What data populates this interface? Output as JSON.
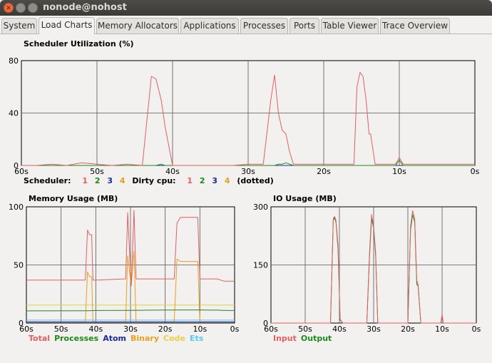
{
  "window": {
    "title": "nonode@nohost"
  },
  "tabs": [
    {
      "label": "System"
    },
    {
      "label": "Load Charts"
    },
    {
      "label": "Memory Allocators"
    },
    {
      "label": "Applications"
    },
    {
      "label": "Processes"
    },
    {
      "label": "Ports"
    },
    {
      "label": "Table Viewer"
    },
    {
      "label": "Trace Overview"
    }
  ],
  "active_tab": "Load Charts",
  "scheduler": {
    "title": "Scheduler Utilization (%)",
    "legend_scheduler_label": "Scheduler:",
    "legend_dirty_label": "Dirty cpu:",
    "legend_suffix": "(dotted)",
    "legend_numbers": [
      "1",
      "2",
      "3",
      "4"
    ],
    "legend_colors": [
      "#e06060",
      "#1a8a1a",
      "#1a2a9a",
      "#e8a020"
    ]
  },
  "memory": {
    "title": "Memory Usage (MB)"
  },
  "io": {
    "title": "IO Usage (MB)"
  },
  "chart_data": [
    {
      "type": "line",
      "title": "Scheduler Utilization (%)",
      "x": [
        60,
        58,
        56,
        54,
        52,
        50,
        48,
        46,
        44,
        42.8,
        42.2,
        41.5,
        41,
        40,
        38,
        36,
        34,
        32,
        30,
        28,
        27,
        26.5,
        26,
        25.5,
        25,
        24.5,
        24,
        22,
        20,
        18,
        16,
        15.6,
        15.2,
        14.8,
        14.4,
        14,
        13.8,
        13.2,
        13,
        12,
        10.5,
        10,
        9.5,
        8,
        6,
        4,
        2,
        0
      ],
      "xlim": [
        60,
        0
      ],
      "ylim": [
        0,
        80
      ],
      "xticks": [
        "60s",
        "50s",
        "40s",
        "30s",
        "20s",
        "10s",
        "0s"
      ],
      "yticks": [
        "80",
        "40",
        "0"
      ],
      "series": [
        {
          "name": "1",
          "color": "#e06060",
          "values": [
            0,
            0,
            1,
            0,
            2,
            1,
            0,
            1,
            0,
            68,
            66,
            50,
            30,
            0,
            0,
            0,
            0,
            0,
            1,
            1,
            50,
            69,
            40,
            27,
            24,
            10,
            1,
            1,
            1,
            1,
            1,
            60,
            71,
            68,
            50,
            24,
            24,
            1,
            1,
            1,
            1,
            6,
            1,
            1,
            1,
            1,
            1,
            1
          ]
        },
        {
          "name": "2",
          "color": "#1a8a1a",
          "values": [
            0,
            0,
            0,
            0,
            0,
            0,
            0,
            0,
            0,
            0,
            0,
            1,
            0,
            0,
            0,
            0,
            0,
            0,
            0,
            0,
            0,
            0,
            1,
            1,
            2,
            1,
            0,
            0,
            0,
            0,
            0,
            0,
            0,
            0,
            0,
            0,
            0,
            0,
            0,
            0,
            0,
            4,
            0,
            0,
            0,
            0,
            0,
            0
          ]
        },
        {
          "name": "3",
          "color": "#1a2a9a",
          "values": [
            0,
            0,
            0,
            0,
            0,
            0,
            0,
            0,
            0,
            0,
            0,
            0,
            0,
            0,
            0,
            0,
            0,
            0,
            0,
            0,
            0,
            0,
            0,
            0,
            0,
            0,
            0,
            0,
            0,
            0,
            0,
            0,
            0,
            0,
            0,
            0,
            0,
            0,
            0,
            0,
            0,
            0,
            0,
            0,
            0,
            0,
            0,
            0
          ]
        },
        {
          "name": "4",
          "color": "#e8a020",
          "values": [
            0,
            0,
            0,
            0,
            0,
            0,
            0,
            0,
            0,
            0,
            0,
            0,
            0,
            0,
            0,
            0,
            0,
            0,
            0,
            0,
            0,
            0,
            0,
            0,
            0,
            0,
            0,
            0,
            0,
            0,
            0,
            0,
            0,
            0,
            0,
            0,
            0,
            0,
            0,
            0,
            0,
            0,
            0,
            0,
            0,
            0,
            0,
            0
          ]
        }
      ]
    },
    {
      "type": "line",
      "title": "Memory Usage (MB)",
      "x": [
        60,
        44,
        43.4,
        43,
        42.4,
        41.8,
        41.2,
        40.8,
        40,
        32,
        31.4,
        30.8,
        29.8,
        29,
        28.4,
        27.6,
        27,
        26.4,
        25.6,
        25,
        24,
        20,
        19.4,
        18.8,
        18.2,
        17.4,
        16.6,
        15.6,
        14.8,
        14.6,
        14,
        12.6,
        11.6,
        10.6,
        10,
        8,
        5,
        3,
        1.5,
        0
      ],
      "xlim": [
        60,
        0
      ],
      "ylim": [
        0,
        100
      ],
      "xticks": [
        "60s",
        "50s",
        "40s",
        "30s",
        "20s",
        "10s",
        "0s"
      ],
      "yticks": [
        "100",
        "50",
        "0"
      ],
      "legend": [
        "Total",
        "Processes",
        "Atom",
        "Binary",
        "Code",
        "Ets"
      ],
      "series": [
        {
          "name": "Total",
          "color": "#e06060",
          "values": [
            37,
            37,
            37,
            37,
            80,
            76,
            76,
            37,
            37,
            38,
            38,
            95,
            32,
            97,
            38,
            38,
            38,
            38,
            38,
            38,
            38,
            38,
            38,
            38,
            38,
            38,
            86,
            91,
            91,
            91,
            91,
            91,
            91,
            91,
            38,
            38,
            38,
            36,
            36,
            36
          ]
        },
        {
          "name": "Processes",
          "color": "#1a8a1a",
          "values": [
            10.5,
            10.6,
            10.6,
            10.6,
            10.6,
            10.7,
            10.7,
            10.8,
            10.8,
            10.9,
            10.9,
            10.9,
            11,
            11,
            11,
            11,
            11,
            11,
            11.1,
            11.1,
            11.1,
            11.2,
            11.2,
            11.2,
            11.2,
            11.2,
            11.3,
            11.3,
            11.3,
            11.3,
            11.3,
            11.3,
            11.3,
            11.3,
            11.3,
            11.2,
            11.1,
            10.9,
            10.8,
            10.8
          ]
        },
        {
          "name": "Atom",
          "color": "#1a2a9a",
          "values": [
            1,
            1,
            1,
            1,
            1,
            1,
            1,
            1,
            1,
            1,
            1,
            1,
            1,
            1,
            1,
            1,
            1,
            1,
            1,
            1,
            1,
            1,
            1,
            1,
            1,
            1,
            1,
            1,
            1,
            1,
            1,
            1,
            1,
            1,
            1,
            1,
            1,
            1,
            1,
            1
          ]
        },
        {
          "name": "Binary",
          "color": "#e8a020",
          "values": [
            1,
            1,
            1,
            1,
            44,
            40,
            40,
            1,
            1,
            1,
            1,
            58,
            32,
            62,
            1,
            1,
            1,
            1,
            1,
            1,
            1,
            1,
            1,
            1,
            1,
            1,
            55,
            53,
            53,
            53,
            53,
            53,
            53,
            53,
            1,
            1,
            1,
            1,
            1,
            1
          ]
        },
        {
          "name": "Code",
          "color": "#e8d040",
          "values": [
            15.5,
            15.5,
            15.5,
            15.5,
            15.5,
            15.5,
            15.5,
            15.5,
            15.5,
            15.5,
            15.5,
            15.5,
            15.5,
            15.5,
            15.5,
            15.5,
            15.5,
            15.5,
            15.5,
            15.5,
            15.5,
            15.5,
            15.5,
            15.5,
            15.5,
            15.5,
            15.5,
            15.5,
            15.5,
            15.5,
            15.5,
            15.5,
            15.5,
            15.5,
            15.5,
            15.5,
            15.5,
            15.5,
            15.5,
            15.5
          ]
        },
        {
          "name": "Ets",
          "color": "#5bc8e8",
          "values": [
            2.5,
            2.5,
            2.5,
            2.5,
            2.5,
            2.5,
            2.5,
            2.5,
            2.5,
            2.5,
            2.5,
            2.5,
            2.5,
            2.5,
            2.5,
            2.5,
            2.5,
            2.5,
            2.5,
            2.5,
            2.5,
            2.5,
            2.5,
            2.5,
            2.5,
            2.5,
            2.5,
            2.5,
            2.5,
            2.5,
            2.5,
            2.5,
            2.5,
            2.5,
            2.5,
            2.5,
            2.5,
            2.5,
            2.5,
            2.5
          ]
        }
      ]
    },
    {
      "type": "line",
      "title": "IO Usage (MB)",
      "x": [
        60,
        42.6,
        41.8,
        41.4,
        41,
        40.4,
        39.8,
        39,
        32,
        31.2,
        30.6,
        30,
        29.4,
        28.8,
        28,
        20,
        19.2,
        18.6,
        18,
        17.4,
        17,
        16.2,
        15,
        10.4,
        10,
        9.6,
        9,
        0
      ],
      "xlim": [
        60,
        0
      ],
      "ylim": [
        0,
        300
      ],
      "xticks": [
        "60s",
        "50s",
        "40s",
        "30s",
        "20s",
        "10s",
        "0s"
      ],
      "yticks": [
        "300",
        "150",
        "0"
      ],
      "legend": [
        "Input",
        "Output"
      ],
      "series": [
        {
          "name": "Input",
          "color": "#e06060",
          "values": [
            0,
            0,
            270,
            275,
            265,
            200,
            10,
            0,
            0,
            180,
            280,
            250,
            180,
            0,
            0,
            0,
            250,
            290,
            270,
            110,
            100,
            0,
            0,
            0,
            22,
            0,
            0,
            0
          ]
        },
        {
          "name": "Output",
          "color": "#1a8a1a",
          "values": [
            0,
            0,
            265,
            272,
            260,
            190,
            8,
            0,
            0,
            170,
            270,
            245,
            170,
            0,
            0,
            0,
            240,
            280,
            260,
            100,
            95,
            0,
            0,
            0,
            0,
            0,
            0,
            0
          ]
        }
      ]
    }
  ]
}
